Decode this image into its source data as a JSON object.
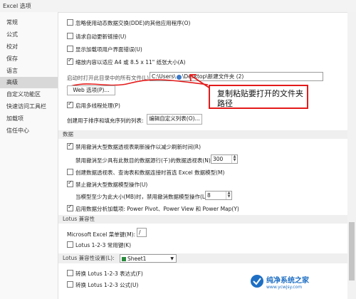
{
  "window": {
    "title": "Excel 选项"
  },
  "sidebar": {
    "items": [
      {
        "label": "常规"
      },
      {
        "label": "公式"
      },
      {
        "label": "校对"
      },
      {
        "label": "保存"
      },
      {
        "label": "语言"
      },
      {
        "label": "高级",
        "active": true
      },
      {
        "label": "自定义功能区"
      },
      {
        "label": "快速访问工具栏"
      },
      {
        "label": "加载项"
      },
      {
        "label": "信任中心"
      }
    ]
  },
  "general": {
    "options": [
      {
        "label": "忽略使用动态数据交换(DDE)的其他应用程序(O)",
        "checked": false
      },
      {
        "label": "请求自动更新链接(U)",
        "checked": false
      },
      {
        "label": "显示加载项用户界面错误(U)",
        "checked": false
      },
      {
        "label": "缩放内容以适应 A4 或 8.5 x 11\" 纸张大小(A)",
        "checked": true
      }
    ],
    "startup_label": "启动时打开此目录中的所有文件(L):",
    "startup_value": "C:\\Users\\",
    "startup_value2": "\\Desktop\\新建文件夹 (2)",
    "web_options_button": "Web 选项(P)...",
    "multithread_label": "启用多线程处理(P)",
    "multithread_checked": true,
    "custom_list_label": "创建用于排序和填充序列的列表:",
    "custom_list_button": "编辑自定义列表(O)..."
  },
  "data_section": {
    "header": "数据",
    "disable_undo_refresh": {
      "label": "禁用撤消大型数据透视表刷新操作以减少刷新时间(R)",
      "checked": true
    },
    "rows_label": "禁用撤消至少具有此数目的数据源行(千)的数据透视表(N):",
    "rows_value": "300",
    "default_model": {
      "label": "创建数据透视表、查询表和数据连接时首选 Excel 数据模型(M)",
      "checked": false
    },
    "disable_undo_model": {
      "label": "禁止撤消大型数据模型操作(U)",
      "checked": true
    },
    "model_size_label": "当模型至少为此大小(MB)时，禁用撤消数据模型操作(L):",
    "model_size_value": "8",
    "data_analysis": {
      "label": "启用数据分析加载项: Power Pivot、Power View 和 Power Map(Y)",
      "checked": true
    }
  },
  "lotus_compat": {
    "header": "Lotus 兼容性",
    "menu_key_label": "Microsoft Excel 菜单键(M):",
    "menu_key_value": "/",
    "nav_keys": {
      "label": "Lotus 1-2-3 常用键(K)",
      "checked": false
    }
  },
  "lotus_settings": {
    "header_label": "Lotus 兼容性设置(L):",
    "sheet_select": "Sheet1",
    "formula_eval": {
      "label": "转换 Lotus 1-2-3 表达式(F)",
      "checked": false
    },
    "formula_entry": {
      "label": "转换 Lotus 1-2-3 公式(U)",
      "checked": false
    }
  },
  "annotation": {
    "text": "复制粘贴要打开的文件夹路径",
    "color": "#e41a1a"
  },
  "watermark": {
    "name": "纯净系统之家",
    "url": "www.ycwjsy.com"
  }
}
